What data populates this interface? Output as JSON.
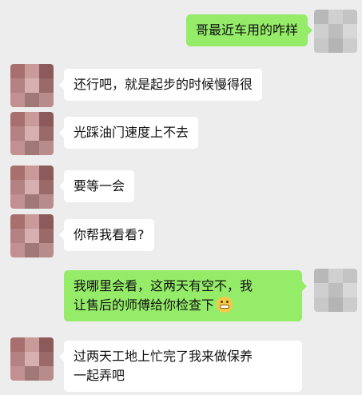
{
  "messages": [
    {
      "side": "right",
      "text": "哥最近车用的咋样"
    },
    {
      "side": "left",
      "text": "还行吧，就是起步的时候慢得很"
    },
    {
      "side": "left",
      "text": "光踩油门速度上不去"
    },
    {
      "side": "left",
      "text": "要等一会"
    },
    {
      "side": "left",
      "text": "你帮我看看?"
    },
    {
      "side": "right",
      "line1": "我哪里会看，这两天有空不，我",
      "line2": "让售后的师傅给你检查下",
      "emoji": "grin-emoji"
    },
    {
      "side": "left",
      "line1": "过两天工地上忙完了我来做保养",
      "line2": "一起弄吧"
    }
  ],
  "avatars": {
    "me": [
      "#b8b8b8",
      "#d0d0d0",
      "#c4c4c4",
      "#cfcfcf",
      "#bdbdbd",
      "#d8d8d8",
      "#c8c8c8",
      "#b4b4b4",
      "#cccccc"
    ],
    "other": [
      "#a86f6f",
      "#c89a9a",
      "#8c5a5a",
      "#b48282",
      "#d6b0b0",
      "#9a6a6a",
      "#c29090",
      "#a07878",
      "#b88c8c"
    ]
  }
}
